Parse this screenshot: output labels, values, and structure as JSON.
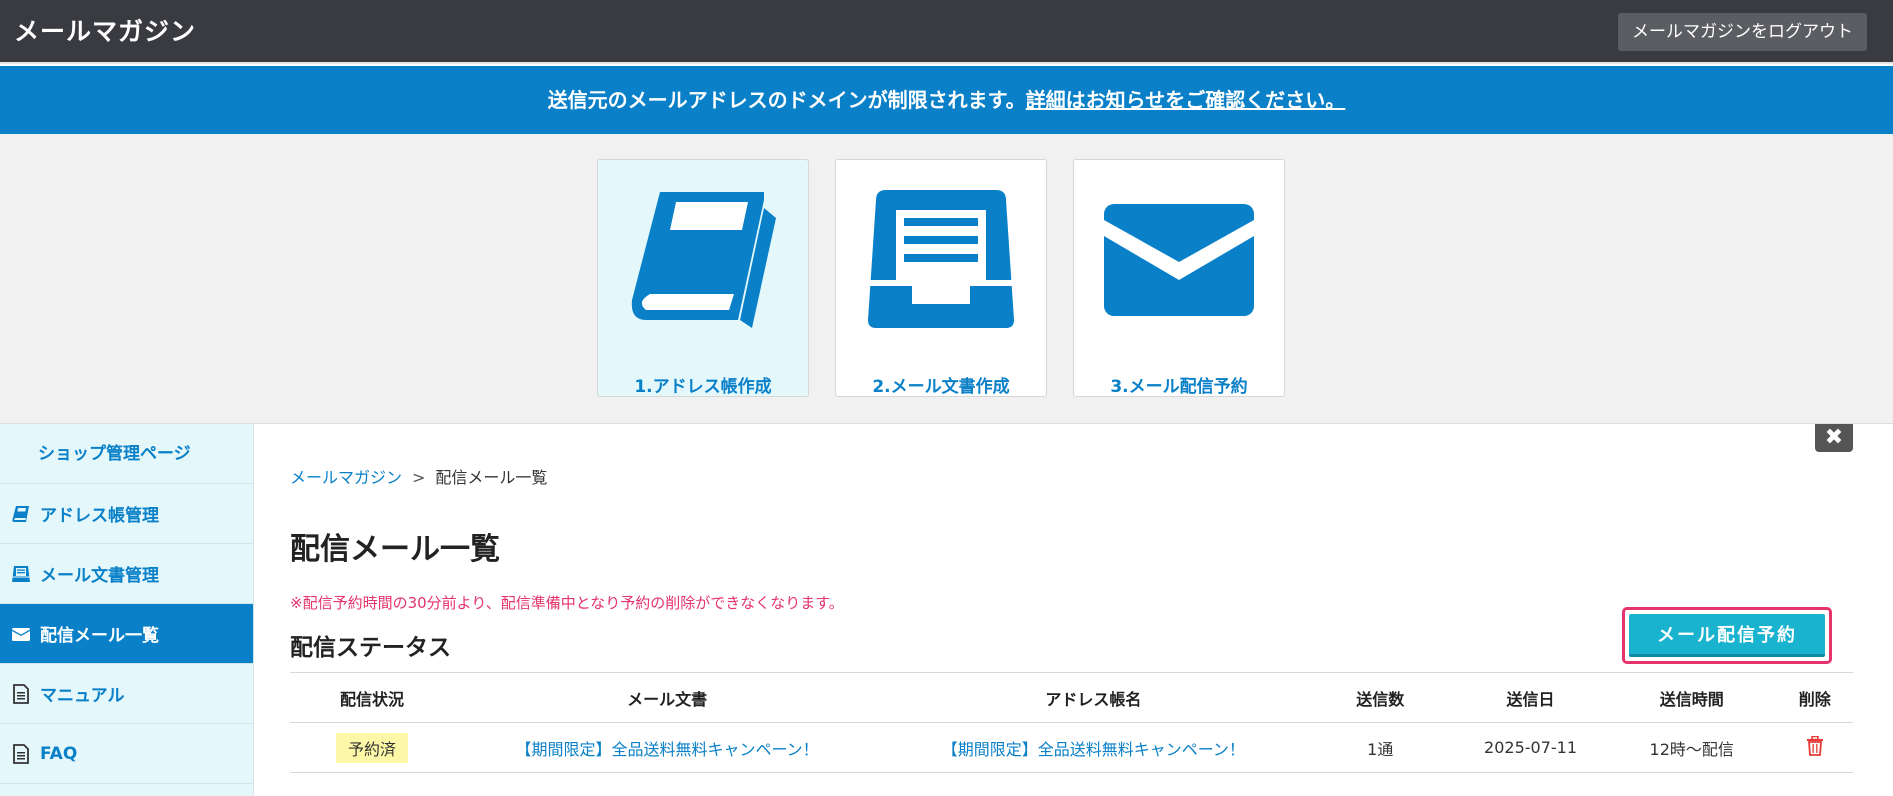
{
  "header": {
    "app_title": "メールマガジン",
    "logout_label": "メールマガジンをログアウト"
  },
  "notice": {
    "text": "送信元のメールアドレスのドメインが制限されます。",
    "link_text": "詳細はお知らせをご確認ください。"
  },
  "steps": [
    {
      "label": "1.アドレス帳作成",
      "icon": "book-icon",
      "active": true
    },
    {
      "label": "2.メール文書作成",
      "icon": "document-tray-icon",
      "active": false
    },
    {
      "label": "3.メール配信予約",
      "icon": "envelope-icon",
      "active": false
    }
  ],
  "sidebar": {
    "head": "ショップ管理ページ",
    "items": [
      {
        "label": "アドレス帳管理",
        "icon": "book-icon",
        "active": false
      },
      {
        "label": "メール文書管理",
        "icon": "document-tray-icon",
        "active": false
      },
      {
        "label": "配信メール一覧",
        "icon": "envelope-icon",
        "active": true
      },
      {
        "label": "マニュアル",
        "icon": "file-icon",
        "active": false
      },
      {
        "label": "FAQ",
        "icon": "file-icon",
        "active": false
      }
    ]
  },
  "close_glyph": "✖",
  "breadcrumb": {
    "home": "メールマガジン",
    "separator": ">",
    "current": "配信メール一覧"
  },
  "page_title": "配信メール一覧",
  "warning": "※配信予約時間の30分前より、配信準備中となり予約の削除ができなくなります。",
  "section_title": "配信ステータス",
  "reserve_button": "メール配信予約",
  "table": {
    "headers": [
      "配信状況",
      "メール文書",
      "アドレス帳名",
      "送信数",
      "送信日",
      "送信時間",
      "削除"
    ],
    "rows": [
      {
        "status": "予約済",
        "document": "【期間限定】全品送料無料キャンペーン！",
        "address_book": "【期間限定】全品送料無料キャンペーン！",
        "count": "1通",
        "date": "2025-07-11",
        "time": "12時～配信"
      }
    ]
  },
  "colors": {
    "topbar": "#393b41",
    "brand_blue": "#0a80c8",
    "sidebar_bg": "#e4f7fb",
    "reserve_button": "#1ab3cf",
    "highlight_outline": "#e5336b",
    "warning_text": "#e5336b",
    "delete_icon": "#e53935"
  }
}
